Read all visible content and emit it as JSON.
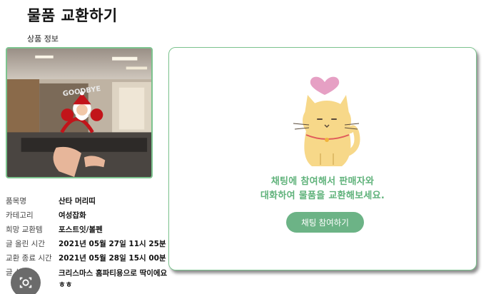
{
  "page": {
    "title": "물품 교환하기",
    "section_label": "상품 정보"
  },
  "product_image": {
    "alt": "산타 머리띠 사진",
    "headband_text": "GOODBYE"
  },
  "info": [
    {
      "key": "품목명",
      "value": "산타 머리띠"
    },
    {
      "key": "카테고리",
      "value": "여성잡화"
    },
    {
      "key": "희망 교환템",
      "value": "포스트잇/볼펜"
    },
    {
      "key": "글 올린 시간",
      "value": "2021년 05월 27일 11시 25분"
    },
    {
      "key": "교환 종료 시간",
      "value": "2021년 05월 28일 15시 00분"
    },
    {
      "key": "글 설명",
      "value": "크리스마스 홈파티용으로 딱이에요 ㅎㅎ"
    }
  ],
  "chat": {
    "message_line1": "채팅에 참여해서 판매자와",
    "message_line2": "대화하여 물품을 교환해보세요.",
    "button_label": "채팅 참여하기"
  },
  "colors": {
    "accent": "#6cb386",
    "accent_text": "#5fb27a",
    "border": "#7cc38e",
    "cat": "#f7d889",
    "heart": "#e6a0c4"
  },
  "icons": [
    "camera-search-icon",
    "heart-icon"
  ]
}
